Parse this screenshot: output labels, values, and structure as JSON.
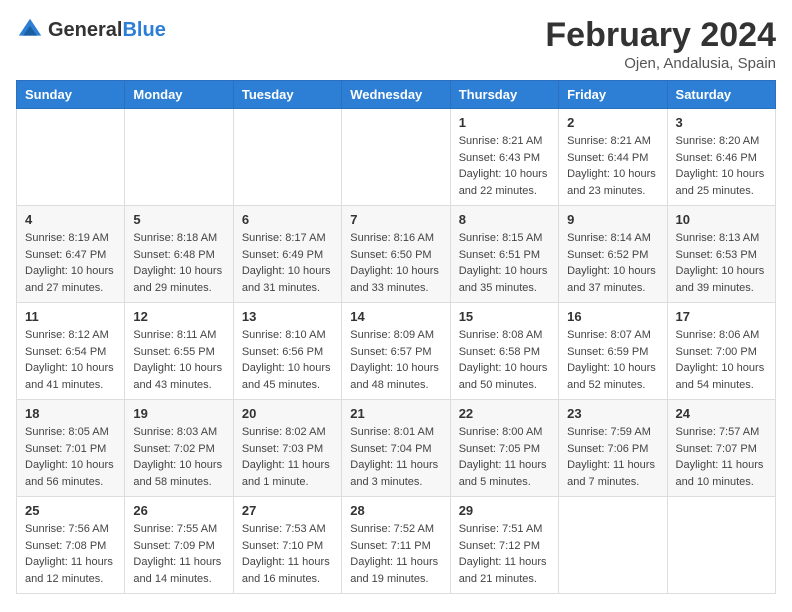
{
  "logo": {
    "general": "General",
    "blue": "Blue"
  },
  "title": "February 2024",
  "location": "Ojen, Andalusia, Spain",
  "days_of_week": [
    "Sunday",
    "Monday",
    "Tuesday",
    "Wednesday",
    "Thursday",
    "Friday",
    "Saturday"
  ],
  "weeks": [
    [
      {
        "day": "",
        "info": ""
      },
      {
        "day": "",
        "info": ""
      },
      {
        "day": "",
        "info": ""
      },
      {
        "day": "",
        "info": ""
      },
      {
        "day": "1",
        "info": "Sunrise: 8:21 AM\nSunset: 6:43 PM\nDaylight: 10 hours\nand 22 minutes."
      },
      {
        "day": "2",
        "info": "Sunrise: 8:21 AM\nSunset: 6:44 PM\nDaylight: 10 hours\nand 23 minutes."
      },
      {
        "day": "3",
        "info": "Sunrise: 8:20 AM\nSunset: 6:46 PM\nDaylight: 10 hours\nand 25 minutes."
      }
    ],
    [
      {
        "day": "4",
        "info": "Sunrise: 8:19 AM\nSunset: 6:47 PM\nDaylight: 10 hours\nand 27 minutes."
      },
      {
        "day": "5",
        "info": "Sunrise: 8:18 AM\nSunset: 6:48 PM\nDaylight: 10 hours\nand 29 minutes."
      },
      {
        "day": "6",
        "info": "Sunrise: 8:17 AM\nSunset: 6:49 PM\nDaylight: 10 hours\nand 31 minutes."
      },
      {
        "day": "7",
        "info": "Sunrise: 8:16 AM\nSunset: 6:50 PM\nDaylight: 10 hours\nand 33 minutes."
      },
      {
        "day": "8",
        "info": "Sunrise: 8:15 AM\nSunset: 6:51 PM\nDaylight: 10 hours\nand 35 minutes."
      },
      {
        "day": "9",
        "info": "Sunrise: 8:14 AM\nSunset: 6:52 PM\nDaylight: 10 hours\nand 37 minutes."
      },
      {
        "day": "10",
        "info": "Sunrise: 8:13 AM\nSunset: 6:53 PM\nDaylight: 10 hours\nand 39 minutes."
      }
    ],
    [
      {
        "day": "11",
        "info": "Sunrise: 8:12 AM\nSunset: 6:54 PM\nDaylight: 10 hours\nand 41 minutes."
      },
      {
        "day": "12",
        "info": "Sunrise: 8:11 AM\nSunset: 6:55 PM\nDaylight: 10 hours\nand 43 minutes."
      },
      {
        "day": "13",
        "info": "Sunrise: 8:10 AM\nSunset: 6:56 PM\nDaylight: 10 hours\nand 45 minutes."
      },
      {
        "day": "14",
        "info": "Sunrise: 8:09 AM\nSunset: 6:57 PM\nDaylight: 10 hours\nand 48 minutes."
      },
      {
        "day": "15",
        "info": "Sunrise: 8:08 AM\nSunset: 6:58 PM\nDaylight: 10 hours\nand 50 minutes."
      },
      {
        "day": "16",
        "info": "Sunrise: 8:07 AM\nSunset: 6:59 PM\nDaylight: 10 hours\nand 52 minutes."
      },
      {
        "day": "17",
        "info": "Sunrise: 8:06 AM\nSunset: 7:00 PM\nDaylight: 10 hours\nand 54 minutes."
      }
    ],
    [
      {
        "day": "18",
        "info": "Sunrise: 8:05 AM\nSunset: 7:01 PM\nDaylight: 10 hours\nand 56 minutes."
      },
      {
        "day": "19",
        "info": "Sunrise: 8:03 AM\nSunset: 7:02 PM\nDaylight: 10 hours\nand 58 minutes."
      },
      {
        "day": "20",
        "info": "Sunrise: 8:02 AM\nSunset: 7:03 PM\nDaylight: 11 hours\nand 1 minute."
      },
      {
        "day": "21",
        "info": "Sunrise: 8:01 AM\nSunset: 7:04 PM\nDaylight: 11 hours\nand 3 minutes."
      },
      {
        "day": "22",
        "info": "Sunrise: 8:00 AM\nSunset: 7:05 PM\nDaylight: 11 hours\nand 5 minutes."
      },
      {
        "day": "23",
        "info": "Sunrise: 7:59 AM\nSunset: 7:06 PM\nDaylight: 11 hours\nand 7 minutes."
      },
      {
        "day": "24",
        "info": "Sunrise: 7:57 AM\nSunset: 7:07 PM\nDaylight: 11 hours\nand 10 minutes."
      }
    ],
    [
      {
        "day": "25",
        "info": "Sunrise: 7:56 AM\nSunset: 7:08 PM\nDaylight: 11 hours\nand 12 minutes."
      },
      {
        "day": "26",
        "info": "Sunrise: 7:55 AM\nSunset: 7:09 PM\nDaylight: 11 hours\nand 14 minutes."
      },
      {
        "day": "27",
        "info": "Sunrise: 7:53 AM\nSunset: 7:10 PM\nDaylight: 11 hours\nand 16 minutes."
      },
      {
        "day": "28",
        "info": "Sunrise: 7:52 AM\nSunset: 7:11 PM\nDaylight: 11 hours\nand 19 minutes."
      },
      {
        "day": "29",
        "info": "Sunrise: 7:51 AM\nSunset: 7:12 PM\nDaylight: 11 hours\nand 21 minutes."
      },
      {
        "day": "",
        "info": ""
      },
      {
        "day": "",
        "info": ""
      }
    ]
  ]
}
